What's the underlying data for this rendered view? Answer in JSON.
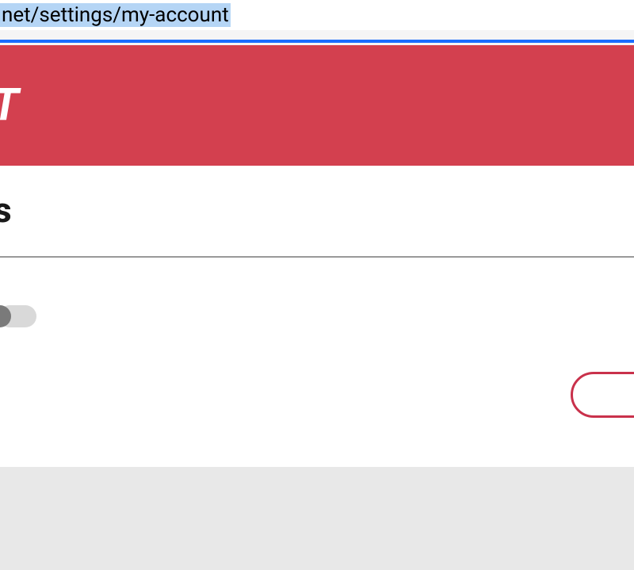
{
  "browser": {
    "url_fragment": "net/settings/my-account"
  },
  "header": {
    "logo_fragment": "T"
  },
  "page": {
    "title_fragment": "s"
  },
  "colors": {
    "brand_red": "#d3404f",
    "accent_pink": "#c9314b",
    "focus_blue": "#1a6dff"
  }
}
